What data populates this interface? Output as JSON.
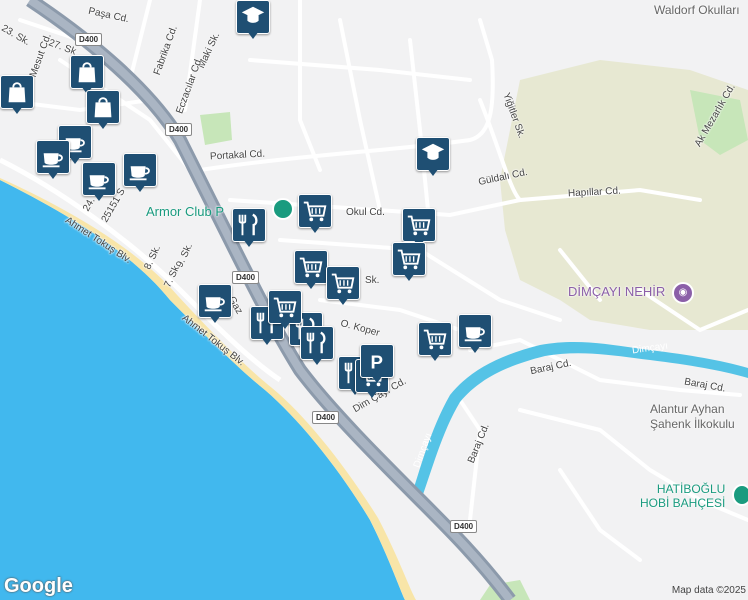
{
  "map": {
    "attribution": "Map data ©2025",
    "logo": "Google",
    "colors": {
      "sea": "#41b8ee",
      "land": "#f2f2f3",
      "beach": "#f8e5a8",
      "highway": "#8c9aab",
      "river": "#55c3e6",
      "park": "#c7e6b9",
      "hill": "#e7e8d2",
      "marker": "#1f4f73"
    },
    "street_labels": [
      {
        "id": "pasa",
        "text": "Paşa Cd."
      },
      {
        "id": "fabrika",
        "text": "Fabrika Cd."
      },
      {
        "id": "maki",
        "text": "Maki Sk."
      },
      {
        "id": "eczacilar",
        "text": "Eczacılar Cd."
      },
      {
        "id": "mesut",
        "text": "Mesut Cd."
      },
      {
        "id": "s23",
        "text": "23. Sk."
      },
      {
        "id": "s27",
        "text": "27. Sk"
      },
      {
        "id": "portakal",
        "text": "Portakal Cd."
      },
      {
        "id": "okul",
        "text": "Okul Cd."
      },
      {
        "id": "yigitler",
        "text": "Yiğitler Sk."
      },
      {
        "id": "guldali",
        "text": "Güldalı Cd."
      },
      {
        "id": "hapillar",
        "text": "Hapıllar Cd."
      },
      {
        "id": "akmezarlik",
        "text": "Ak Mezarlık Cd."
      },
      {
        "id": "ahmet1",
        "text": "Ahmet Tokuş Blv."
      },
      {
        "id": "ahmet2",
        "text": "Ahmet Tokuş Blv."
      },
      {
        "id": "s24",
        "text": "24. S"
      },
      {
        "id": "s25151",
        "text": "25151 S"
      },
      {
        "id": "s8",
        "text": "8. Sk."
      },
      {
        "id": "s9",
        "text": "9. Sk."
      },
      {
        "id": "s7",
        "text": "7. Sk."
      },
      {
        "id": "okoper",
        "text": "O. Koper"
      },
      {
        "id": "baraj1",
        "text": "Baraj Cd."
      },
      {
        "id": "baraj2",
        "text": "Baraj Cd."
      },
      {
        "id": "baraj3",
        "text": "Baraj Cd."
      },
      {
        "id": "dimcayi_road",
        "text": "Dim Çayı Cd."
      },
      {
        "id": "dimcayi_river",
        "text": "Dimçayı"
      },
      {
        "id": "dimcayi_river2",
        "text": "Dimçayı"
      },
      {
        "id": "sk_small",
        "text": "Sk."
      },
      {
        "id": "yaz",
        "text": "Gaz"
      }
    ],
    "highway_shields": [
      "D400",
      "D400",
      "D400",
      "D400",
      "D400"
    ],
    "pois": [
      {
        "id": "armor",
        "text": "Armor Club P",
        "icon": "park-pin-icon"
      },
      {
        "id": "dimcayi_nehir",
        "text": "DİMÇAYI NEHİR",
        "icon": "camera-icon"
      },
      {
        "id": "hatiboglu",
        "text": "HATİBOĞLU\nHOBİ BAHÇESİ",
        "icon": "camera-icon"
      }
    ],
    "places": [
      {
        "id": "waldorf",
        "text": "Waldorf Okulları"
      },
      {
        "id": "alantur",
        "text": "Alantur Ayhan\nŞahenk İlkokulu"
      }
    ],
    "markers": [
      {
        "type": "school"
      },
      {
        "type": "school"
      },
      {
        "type": "shopping"
      },
      {
        "type": "shopping"
      },
      {
        "type": "shopping"
      },
      {
        "type": "cafe"
      },
      {
        "type": "cafe"
      },
      {
        "type": "cafe"
      },
      {
        "type": "cafe"
      },
      {
        "type": "cafe"
      },
      {
        "type": "cafe"
      },
      {
        "type": "restaurant"
      },
      {
        "type": "restaurant"
      },
      {
        "type": "restaurant"
      },
      {
        "type": "restaurant"
      },
      {
        "type": "restaurant"
      },
      {
        "type": "grocery"
      },
      {
        "type": "grocery"
      },
      {
        "type": "grocery"
      },
      {
        "type": "grocery"
      },
      {
        "type": "grocery"
      },
      {
        "type": "grocery"
      },
      {
        "type": "grocery"
      },
      {
        "type": "grocery"
      },
      {
        "type": "parking"
      }
    ]
  }
}
